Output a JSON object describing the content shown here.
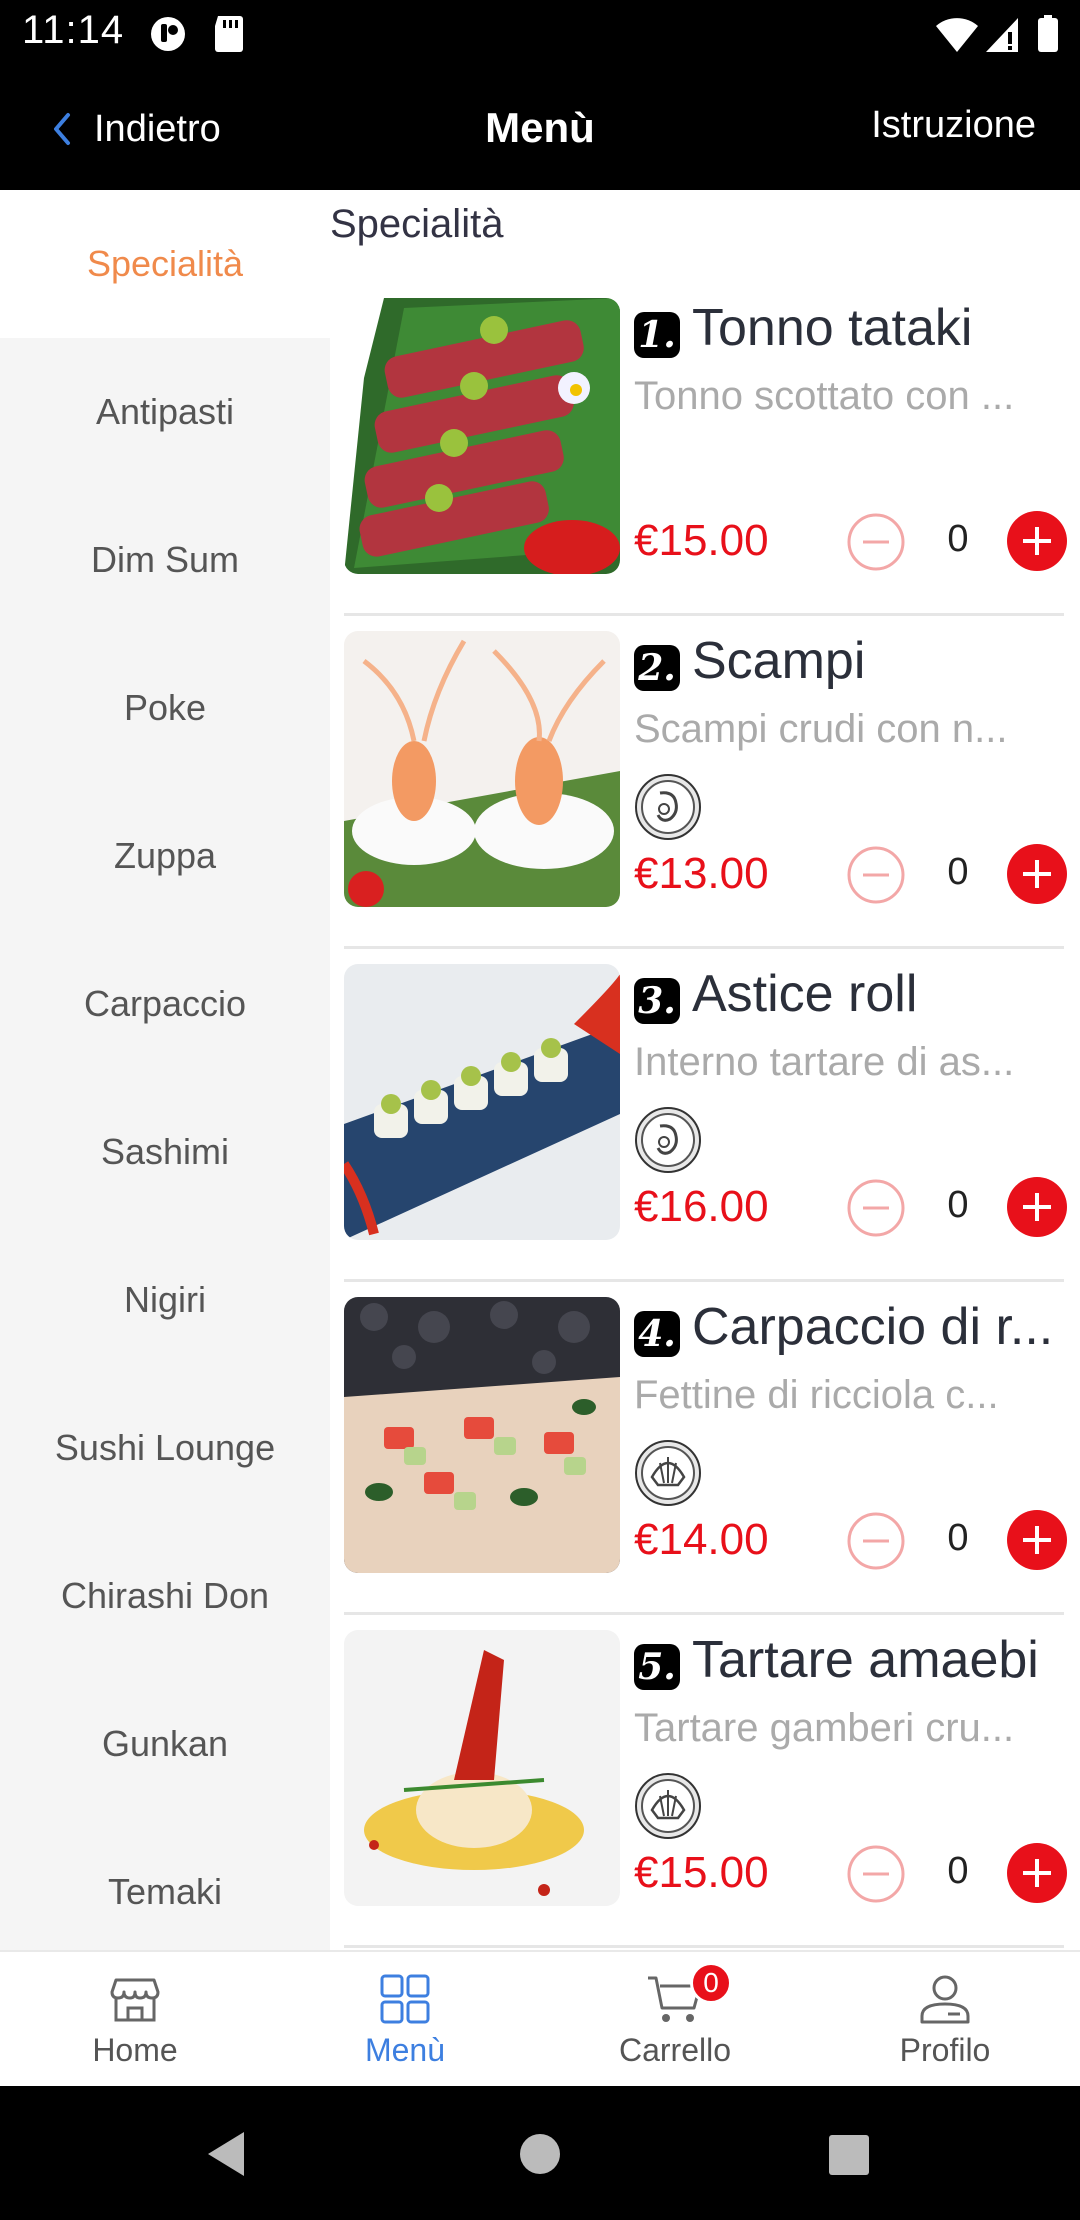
{
  "status_bar": {
    "time": "11:14"
  },
  "header": {
    "back_label": "Indietro",
    "title": "Menù",
    "right_label": "Istruzione"
  },
  "sidebar": {
    "categories": [
      {
        "label": "Specialità",
        "active": true
      },
      {
        "label": "Antipasti"
      },
      {
        "label": "Dim Sum"
      },
      {
        "label": "Poke"
      },
      {
        "label": "Zuppa"
      },
      {
        "label": "Carpaccio"
      },
      {
        "label": "Sashimi"
      },
      {
        "label": "Nigiri"
      },
      {
        "label": "Sushi Lounge"
      },
      {
        "label": "Chirashi Don"
      },
      {
        "label": "Gunkan"
      },
      {
        "label": "Temaki"
      }
    ]
  },
  "main": {
    "section_title": "Specialità",
    "dishes": [
      {
        "num": "1.",
        "name": "Tonno tataki",
        "desc": "Tonno scottato con ...",
        "price": "€15.00",
        "qty": "0",
        "allergen": ""
      },
      {
        "num": "2.",
        "name": "Scampi",
        "desc": "Scampi crudi con n...",
        "price": "€13.00",
        "qty": "0",
        "allergen": "shrimp-allergen-icon"
      },
      {
        "num": "3.",
        "name": "Astice roll",
        "desc": "Interno tartare di as...",
        "price": "€16.00",
        "qty": "0",
        "allergen": "shrimp-allergen-icon"
      },
      {
        "num": "4.",
        "name": "Carpaccio di r...",
        "desc": "Fettine di ricciola c...",
        "price": "€14.00",
        "qty": "0",
        "allergen": "shell-allergen-icon"
      },
      {
        "num": "5.",
        "name": "Tartare amaebi",
        "desc": "Tartare gamberi cru...",
        "price": "€15.00",
        "qty": "0",
        "allergen": "shell-allergen-icon"
      }
    ]
  },
  "tabbar": {
    "tabs": [
      {
        "label": "Home",
        "icon": "store-icon"
      },
      {
        "label": "Menù",
        "icon": "grid-icon",
        "active": true
      },
      {
        "label": "Carrello",
        "icon": "cart-icon",
        "badge": "0"
      },
      {
        "label": "Profilo",
        "icon": "user-icon"
      }
    ]
  },
  "colors": {
    "accent_orange": "#f08a4b",
    "price_red": "#e8101a",
    "active_blue": "#3d7fe0"
  }
}
